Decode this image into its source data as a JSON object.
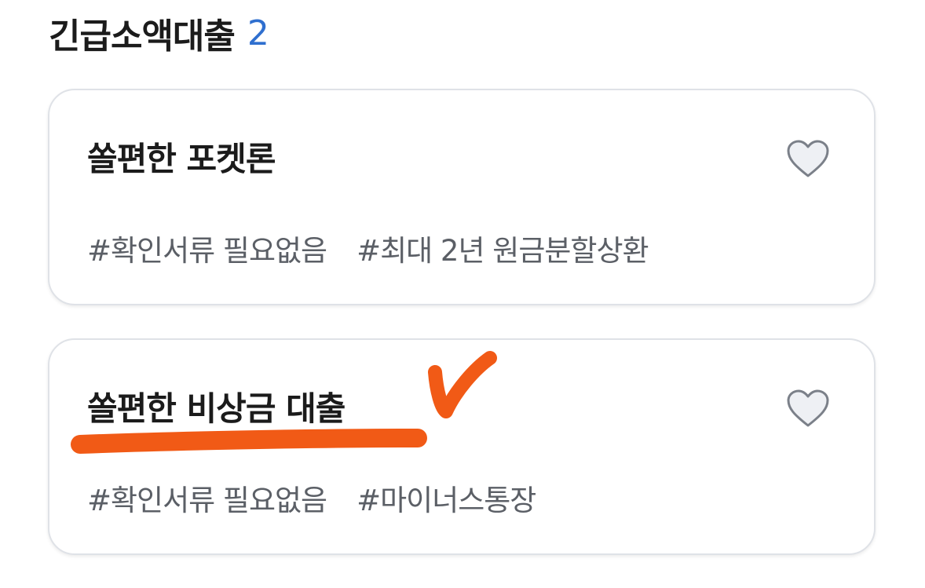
{
  "section": {
    "title": "긴급소액대출",
    "count": "2"
  },
  "cards": [
    {
      "title": "쏠편한 포켓론",
      "tags": [
        "#확인서류 필요없음",
        "#최대 2년 원금분할상환"
      ],
      "favorite_icon": "heart-outline-icon"
    },
    {
      "title": "쏠편한 비상금 대출",
      "tags": [
        "#확인서류 필요없음",
        "#마이너스통장"
      ],
      "favorite_icon": "heart-outline-icon"
    }
  ],
  "annotations": {
    "highlight_color": "#f15a16",
    "marks": [
      "underline",
      "checkmark"
    ]
  },
  "colors": {
    "count_accent": "#2f6fcf",
    "tag_text": "#5b5f66",
    "card_border": "#dfe2e7"
  }
}
